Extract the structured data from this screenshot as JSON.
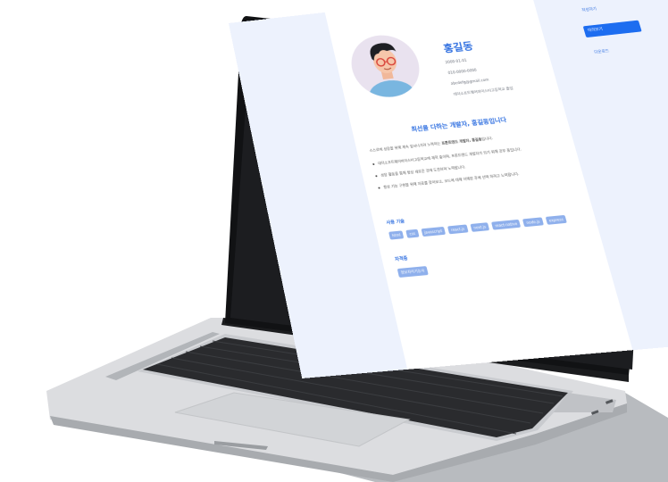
{
  "profile": {
    "name": "홍길동",
    "birth": "2000-01-01",
    "phone": "010-0000-0000",
    "email": "abcdefg@gmail.com",
    "school": "대덕소프트웨어마이스터고등학교 졸업"
  },
  "headline": "최선을 다하는 개발자, 홍길동입니다",
  "intro": {
    "prefix": "스스로에 성장을 위해 계속 앞서나가려 노력하는 ",
    "bold": "프론트엔드 개발자, 홍길동",
    "suffix": "입니다."
  },
  "bullets": [
    "대덕소프트웨어마이스터고등학교에 재학 중이며, 프론트엔드 개발자가 되기 위해 공부 중입니다.",
    "성장 활동을 통해 항상 새로운 것에 도전하려 노력합니다.",
    "항상 기능 구현을 위해 자료를 찾아보고, 코드에 대해 이해한 후에 선택 하려고 노력합니다."
  ],
  "skills_title": "사용 기술",
  "skills": [
    "html",
    "css",
    "javascript",
    "react.js",
    "next.js",
    "react-native",
    "node.js",
    "express"
  ],
  "cert_title": "자격증",
  "cert_tag": "정보처리기능사",
  "menu": {
    "write": "작성하기",
    "preview": "미리보기",
    "download": "다운로드"
  }
}
